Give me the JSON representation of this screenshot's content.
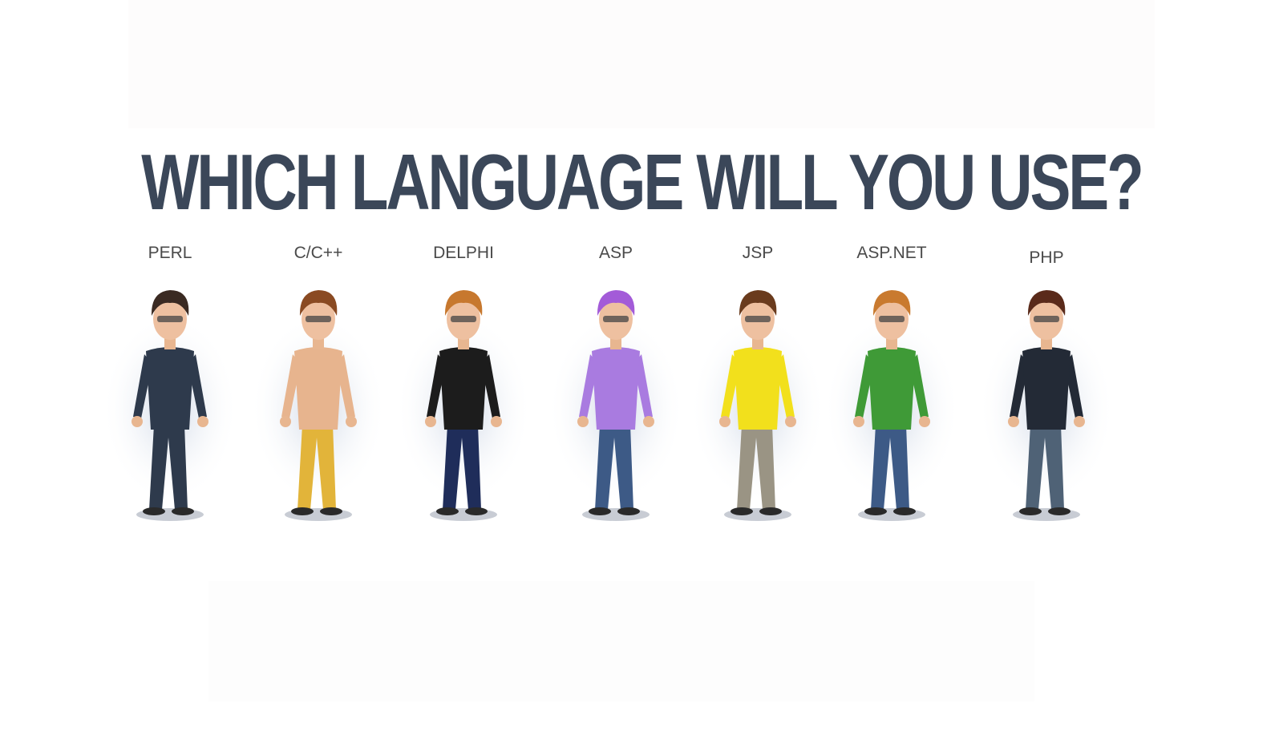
{
  "title": "WHICH LANGUAGE WILL YOU USE?",
  "characters": [
    {
      "label": "PERL",
      "outfit": "tuxedo",
      "colors": {
        "top": "#2e3a4c",
        "bottom": "#2e3a4c",
        "hair": "#3a2a22"
      }
    },
    {
      "label": "C/C++",
      "outfit": "towel",
      "colors": {
        "top": "#e7b48e",
        "bottom": "#e2b43a",
        "hair": "#8a4a22"
      }
    },
    {
      "label": "DELPHI",
      "outfit": "black jacket",
      "colors": {
        "top": "#1c1c1c",
        "bottom": "#1f2d5a",
        "hair": "#c7782e"
      }
    },
    {
      "label": "ASP",
      "outfit": "purple shirt",
      "colors": {
        "top": "#a97be0",
        "bottom": "#3d5a86",
        "hair": "#a35bd8"
      }
    },
    {
      "label": "JSP",
      "outfit": "yellow shirt",
      "colors": {
        "top": "#f2e01c",
        "bottom": "#9a9484",
        "hair": "#6a3b1d"
      }
    },
    {
      "label": "ASP.NET",
      "outfit": "green shirt",
      "colors": {
        "top": "#3f9a37",
        "bottom": "#3d5a86",
        "hair": "#c97a2f"
      }
    },
    {
      "label": "PHP",
      "outfit": "dark blazer",
      "colors": {
        "top": "#232a36",
        "bottom": "#4f6276",
        "hair": "#5a2a1a"
      }
    }
  ]
}
